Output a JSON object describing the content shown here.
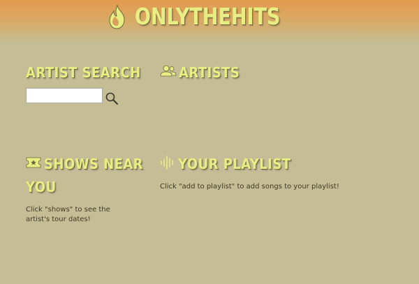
{
  "app": {
    "title": "ONLYTHEHITS",
    "logo_icon": "flame-icon"
  },
  "colors": {
    "background": "#c5bd95",
    "header_top": "#e49a4e",
    "heading_text": "#e8ee84"
  },
  "artist_search": {
    "heading": "ARTIST SEARCH",
    "input_value": "",
    "input_placeholder": "",
    "button_icon": "search-icon"
  },
  "artists": {
    "heading": "ARTISTS",
    "icon": "users-icon"
  },
  "shows": {
    "heading_line1": "SHOWS NEAR",
    "heading_line2": "YOU",
    "icon": "ticket-icon",
    "hint": "Click \"shows\" to see the artist's tour dates!"
  },
  "playlist": {
    "heading": "YOUR PLAYLIST",
    "icon": "audio-waveform-icon",
    "hint": "Click \"add to playlist\" to add songs to your playlist!"
  }
}
